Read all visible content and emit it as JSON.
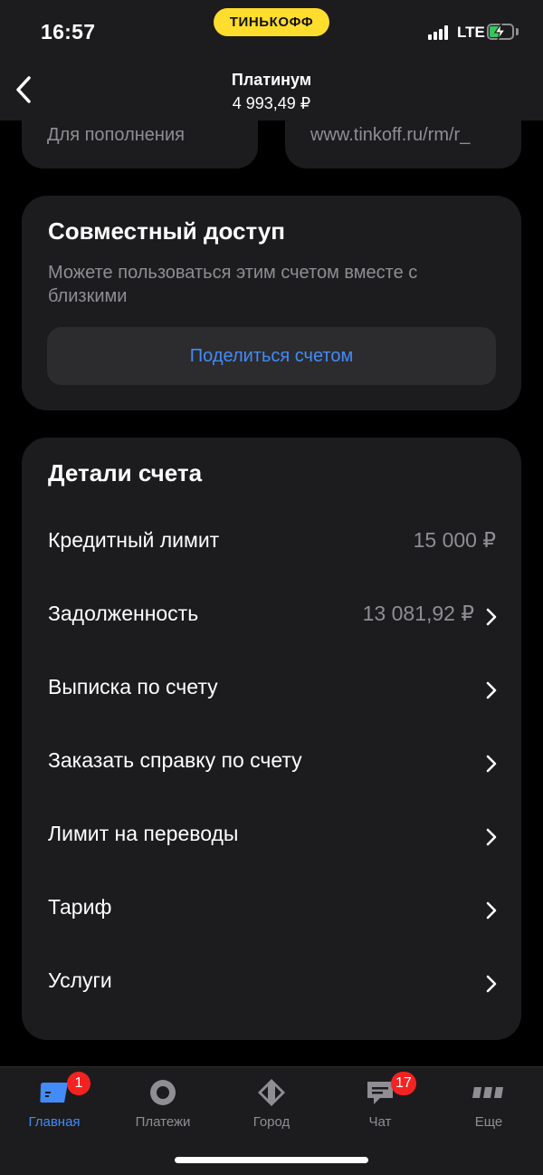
{
  "status_bar": {
    "time": "16:57",
    "brand": "ТИНЬКОФФ",
    "network": "LTE",
    "battery_level": 0.55,
    "colors": {
      "brand": "#ffdd2d",
      "battery": "#34c759"
    }
  },
  "header": {
    "title": "Платинум",
    "balance": "4 993,49 ₽"
  },
  "top_cards": {
    "left_text": "Для пополнения",
    "right_text": "www.tinkoff.ru/rm/r_"
  },
  "shared_access": {
    "title": "Совместный доступ",
    "description": "Можете пользоваться этим счетом вместе с близкими",
    "share_button": "Поделиться счетом"
  },
  "account_details": {
    "title": "Детали счета",
    "rows": [
      {
        "label": "Кредитный лимит",
        "value": "15 000 ₽",
        "chevron": false
      },
      {
        "label": "Задолженность",
        "value": "13 081,92 ₽",
        "chevron": true
      },
      {
        "label": "Выписка по счету",
        "value": "",
        "chevron": true
      },
      {
        "label": "Заказать справку по счету",
        "value": "",
        "chevron": true
      },
      {
        "label": "Лимит на переводы",
        "value": "",
        "chevron": true
      },
      {
        "label": "Тариф",
        "value": "",
        "chevron": true
      },
      {
        "label": "Услуги",
        "value": "",
        "chevron": true
      }
    ]
  },
  "tab_bar": {
    "tabs": [
      {
        "label": "Главная",
        "icon": "home-card-icon",
        "active": true,
        "badge": "1"
      },
      {
        "label": "Платежи",
        "icon": "payments-circle-icon",
        "active": false,
        "badge": ""
      },
      {
        "label": "Город",
        "icon": "city-diamond-icon",
        "active": false,
        "badge": ""
      },
      {
        "label": "Чат",
        "icon": "chat-bubble-icon",
        "active": false,
        "badge": "17"
      },
      {
        "label": "Еще",
        "icon": "more-dots-icon",
        "active": false,
        "badge": ""
      }
    ],
    "colors": {
      "active": "#428bf9",
      "inactive": "#8e8e93",
      "badge": "#f52222"
    }
  }
}
